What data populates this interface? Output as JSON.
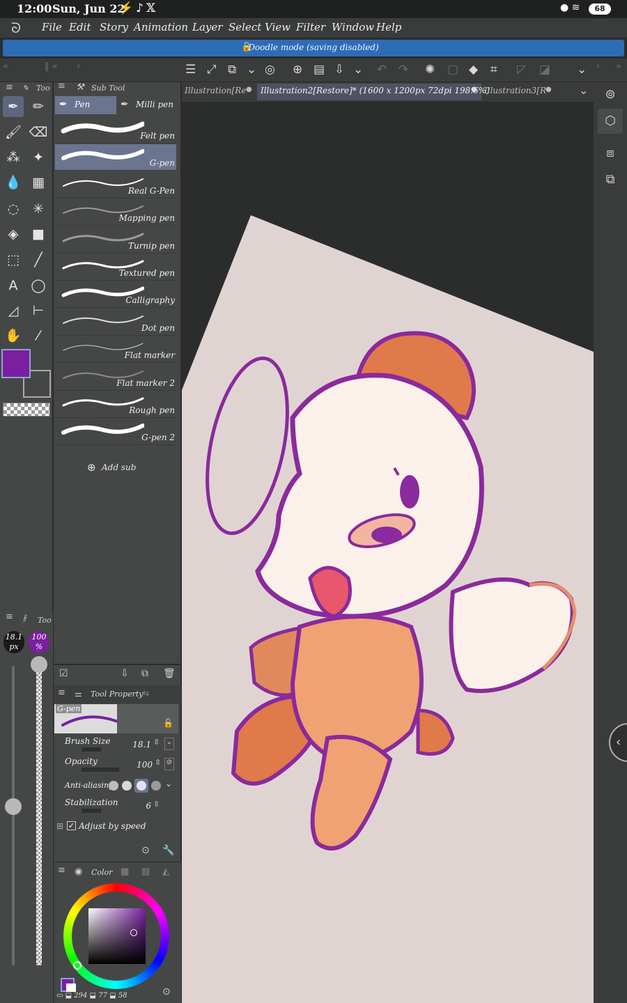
{
  "status": {
    "time": "12:00",
    "date": "Sun, Jun 22",
    "battery": "68"
  },
  "menu": {
    "items": [
      "File",
      "Edit",
      "Story",
      "Animation",
      "Layer",
      "Select",
      "View",
      "Filter",
      "Window",
      "Help"
    ]
  },
  "banner": {
    "text": "Doodle mode (saving disabled)"
  },
  "tabs": {
    "tab1": "Illustration[Re",
    "tab2": "Illustration2[Restore]* (1600 x 1200px 72dpi 198.6%)",
    "tab3": "Illustration3[R"
  },
  "tool_panel": {
    "header": "Too"
  },
  "subtool": {
    "header": "Sub Tool",
    "group_tabs": [
      "Pen",
      "Milli pen"
    ],
    "brushes": [
      "Felt pen",
      "G-pen",
      "Real G-Pen",
      "Mapping pen",
      "Turnip pen",
      "Textured pen",
      "Calligraphy",
      "Dot pen",
      "Flat marker",
      "Flat marker 2",
      "Rough pen",
      "G-pen 2"
    ],
    "selected": "G-pen",
    "add_label": "Add sub"
  },
  "size_panel": {
    "header": "Too",
    "size_value": "18.1",
    "size_unit": "px",
    "opacity_value": "100",
    "opacity_unit": "%"
  },
  "tool_property": {
    "header": "Tool Property",
    "preview_label": "G-pen",
    "brush_size_label": "Brush Size",
    "brush_size_value": "18.1",
    "opacity_label": "Opacity",
    "opacity_value": "100",
    "antialias_label": "Anti-aliasing",
    "stabilization_label": "Stabilization",
    "stabilization_value": "6",
    "adjust_label": "Adjust by speed"
  },
  "color_panel": {
    "header": "Color",
    "h": "294",
    "s": "77",
    "v": "58",
    "main_color": "#7a1fa0",
    "sub_color": "#ffffff"
  },
  "colors": {
    "accent_blue": "#2f6cb6",
    "canvas_paper": "#e0d4d2",
    "line_purple": "#8a2a9c"
  }
}
